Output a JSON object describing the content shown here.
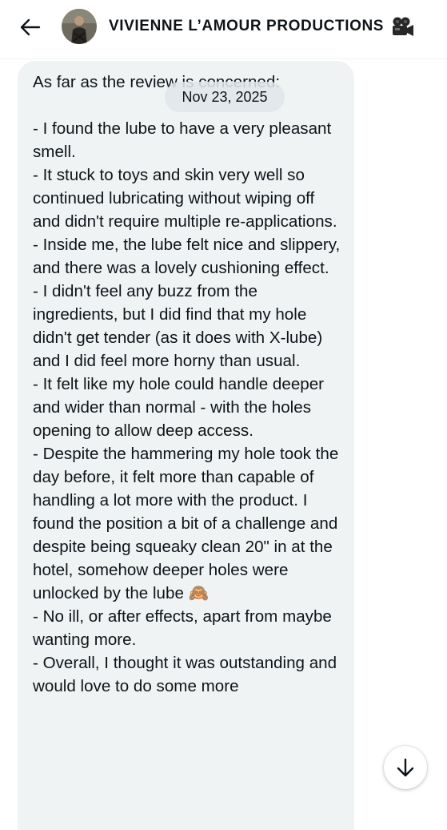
{
  "header": {
    "title": "VIVIENNE L’AMOUR PRODUCTIONS",
    "title_emoji_icon": "movie-camera-icon",
    "back_icon": "back-arrow-icon",
    "avatar_icon": "profile-avatar"
  },
  "conversation": {
    "date_label": "Nov 23, 2025",
    "message": {
      "text": "As far as the review is concerned:\n\n- I found the lube to have a very pleasant smell.\n- It stuck to toys and skin very well so continued lubricating without wiping off and didn't require multiple re-applications.\n- Inside me, the lube felt nice and slippery, and there was a lovely cushioning effect.\n- I didn't feel any buzz from the ingredients, but I did find that my hole didn't get tender (as it does with X-lube) and I did feel more horny than usual.\n- It felt like my hole could handle deeper and wider than normal - with the holes opening to allow deep access.\n- Despite the hammering my hole took the day before, it felt more than capable of handling a lot more with the product. I found the position a bit of a challenge and despite being squeaky clean 20\" in at the hotel, somehow deeper holes were unlocked by the lube 🙈\n- No ill, or after effects, apart from maybe wanting more.\n- Overall, I thought it was outstanding and would love to do some more"
    }
  },
  "scroll_button": {
    "icon": "arrow-down-icon"
  },
  "colors": {
    "bubble_bg": "#eff3f4",
    "date_pill_bg": "#e0e6e9",
    "text": "#0f1419",
    "header_divider": "#eff3f4"
  }
}
